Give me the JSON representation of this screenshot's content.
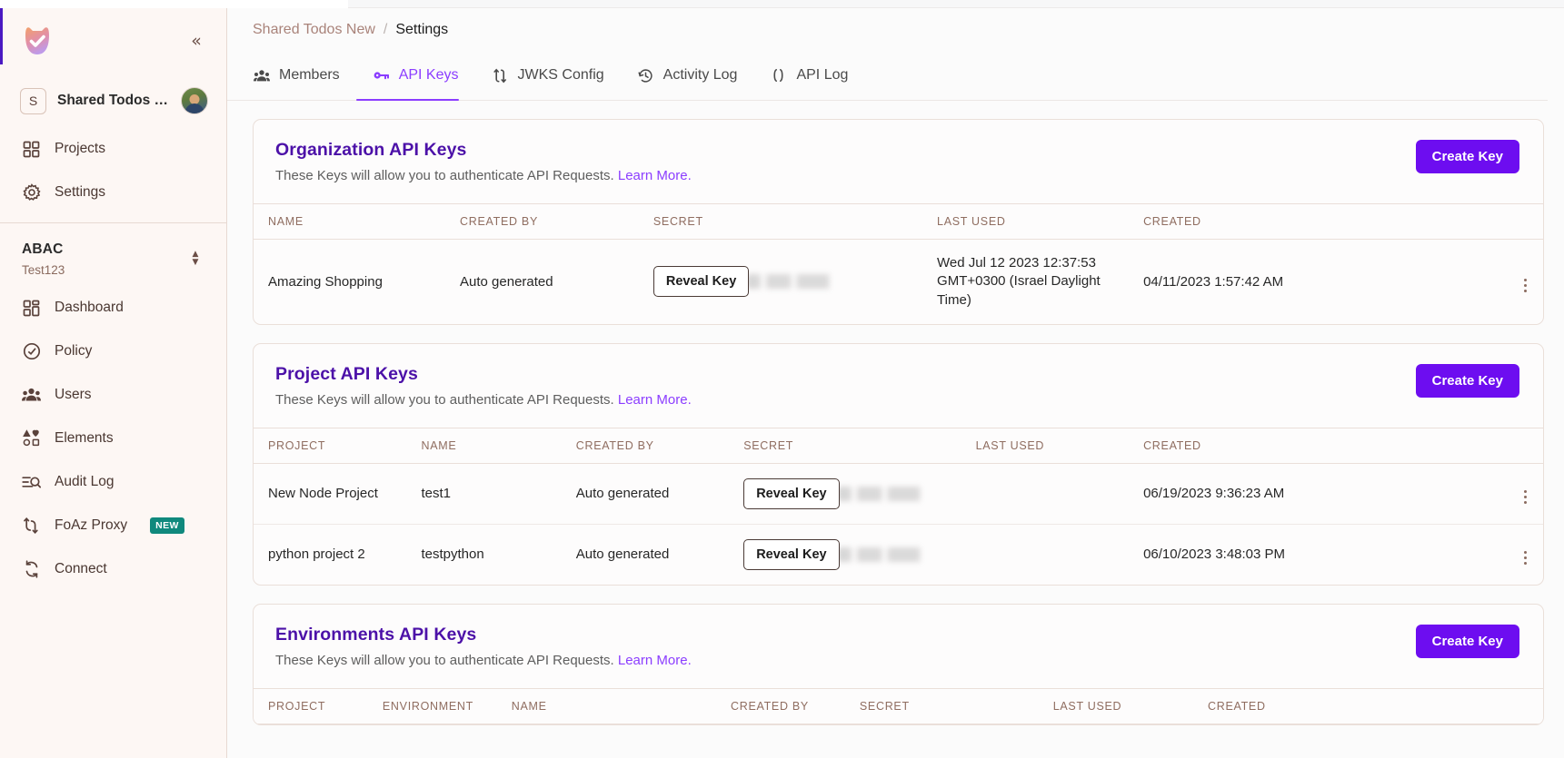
{
  "sidebar": {
    "logo_name": "permit-logo",
    "collapse_label": "«",
    "org": {
      "badge": "S",
      "name": "Shared Todos …",
      "avatar_name": "user-avatar"
    },
    "primary_nav": [
      {
        "label": "Projects",
        "icon": "grid-icon"
      },
      {
        "label": "Settings",
        "icon": "gear-icon"
      }
    ],
    "workspace": {
      "title": "ABAC",
      "subtitle": "Test123"
    },
    "secondary_nav": [
      {
        "label": "Dashboard",
        "icon": "dashboard-icon",
        "badge": ""
      },
      {
        "label": "Policy",
        "icon": "policy-icon",
        "badge": ""
      },
      {
        "label": "Users",
        "icon": "users-icon",
        "badge": ""
      },
      {
        "label": "Elements",
        "icon": "elements-icon",
        "badge": ""
      },
      {
        "label": "Audit Log",
        "icon": "audit-log-icon",
        "badge": ""
      },
      {
        "label": "FoAz Proxy",
        "icon": "foaz-proxy-icon",
        "badge": "NEW"
      },
      {
        "label": "Connect",
        "icon": "connect-icon",
        "badge": ""
      }
    ]
  },
  "breadcrumb": {
    "parent": "Shared Todos New",
    "separator": "/",
    "current": "Settings"
  },
  "tabs": [
    {
      "label": "Members",
      "icon": "members-icon",
      "active": false
    },
    {
      "label": "API Keys",
      "icon": "key-icon",
      "active": true
    },
    {
      "label": "JWKS Config",
      "icon": "jwks-icon",
      "active": false
    },
    {
      "label": "Activity Log",
      "icon": "clock-icon",
      "active": false
    },
    {
      "label": "API Log",
      "icon": "code-icon",
      "active": false
    }
  ],
  "sections": [
    {
      "title": "Organization API Keys",
      "desc": "These Keys will allow you to authenticate API Requests.",
      "learn_more": "Learn More.",
      "create_label": "Create Key",
      "columns": [
        "NAME",
        "CREATED BY",
        "SECRET",
        "LAST USED",
        "CREATED"
      ],
      "rows": [
        {
          "name": "Amazing Shopping",
          "created_by": "Auto generated",
          "reveal_label": "Reveal Key",
          "last_used": "Wed Jul 12 2023 12:37:53 GMT+0300 (Israel Daylight Time)",
          "created": "04/11/2023 1:57:42 AM"
        }
      ]
    },
    {
      "title": "Project API Keys",
      "desc": "These Keys will allow you to authenticate API Requests.",
      "learn_more": "Learn More.",
      "create_label": "Create Key",
      "columns": [
        "PROJECT",
        "NAME",
        "CREATED BY",
        "SECRET",
        "LAST USED",
        "CREATED"
      ],
      "rows": [
        {
          "project": "New Node Project",
          "name": "test1",
          "created_by": "Auto generated",
          "reveal_label": "Reveal Key",
          "last_used": "",
          "created": "06/19/2023 9:36:23 AM"
        },
        {
          "project": "python project 2",
          "name": "testpython",
          "created_by": "Auto generated",
          "reveal_label": "Reveal Key",
          "last_used": "",
          "created": "06/10/2023 3:48:03 PM"
        }
      ]
    },
    {
      "title": "Environments API Keys",
      "desc": "These Keys will allow you to authenticate API Requests.",
      "learn_more": "Learn More.",
      "create_label": "Create Key",
      "columns": [
        "PROJECT",
        "ENVIRONMENT",
        "NAME",
        "CREATED BY",
        "SECRET",
        "LAST USED",
        "CREATED"
      ],
      "rows": []
    }
  ],
  "colors": {
    "accent": "#6d0df0",
    "tab_active": "#8b3dff",
    "card_title": "#4c11a8",
    "sidebar_bg": "#fdf7f4",
    "badge_new": "#10897d"
  }
}
